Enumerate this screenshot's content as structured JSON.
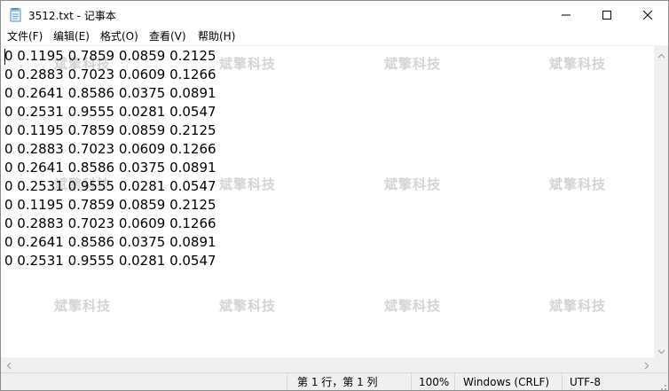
{
  "window": {
    "title": "3512.txt - 记事本"
  },
  "menu": {
    "file": "文件(F)",
    "edit": "编辑(E)",
    "format": "格式(O)",
    "view": "查看(V)",
    "help": "帮助(H)"
  },
  "editor": {
    "lines": [
      "0 0.1195 0.7859 0.0859 0.2125",
      "0 0.2883 0.7023 0.0609 0.1266",
      "0 0.2641 0.8586 0.0375 0.0891",
      "0 0.2531 0.9555 0.0281 0.0547",
      "0 0.1195 0.7859 0.0859 0.2125",
      "0 0.2883 0.7023 0.0609 0.1266",
      "0 0.2641 0.8586 0.0375 0.0891",
      "0 0.2531 0.9555 0.0281 0.0547",
      "0 0.1195 0.7859 0.0859 0.2125",
      "0 0.2883 0.7023 0.0609 0.1266",
      "0 0.2641 0.8586 0.0375 0.0891",
      "0 0.2531 0.9555 0.0281 0.0547"
    ],
    "watermark": "斌擎科技"
  },
  "status": {
    "position": "第 1 行，第 1 列",
    "zoom": "100%",
    "line_ending": "Windows (CRLF)",
    "encoding": "UTF-8"
  },
  "icons": {
    "app": "notepad-icon",
    "minimize": "minimize-icon",
    "maximize": "maximize-icon",
    "close": "close-icon"
  }
}
